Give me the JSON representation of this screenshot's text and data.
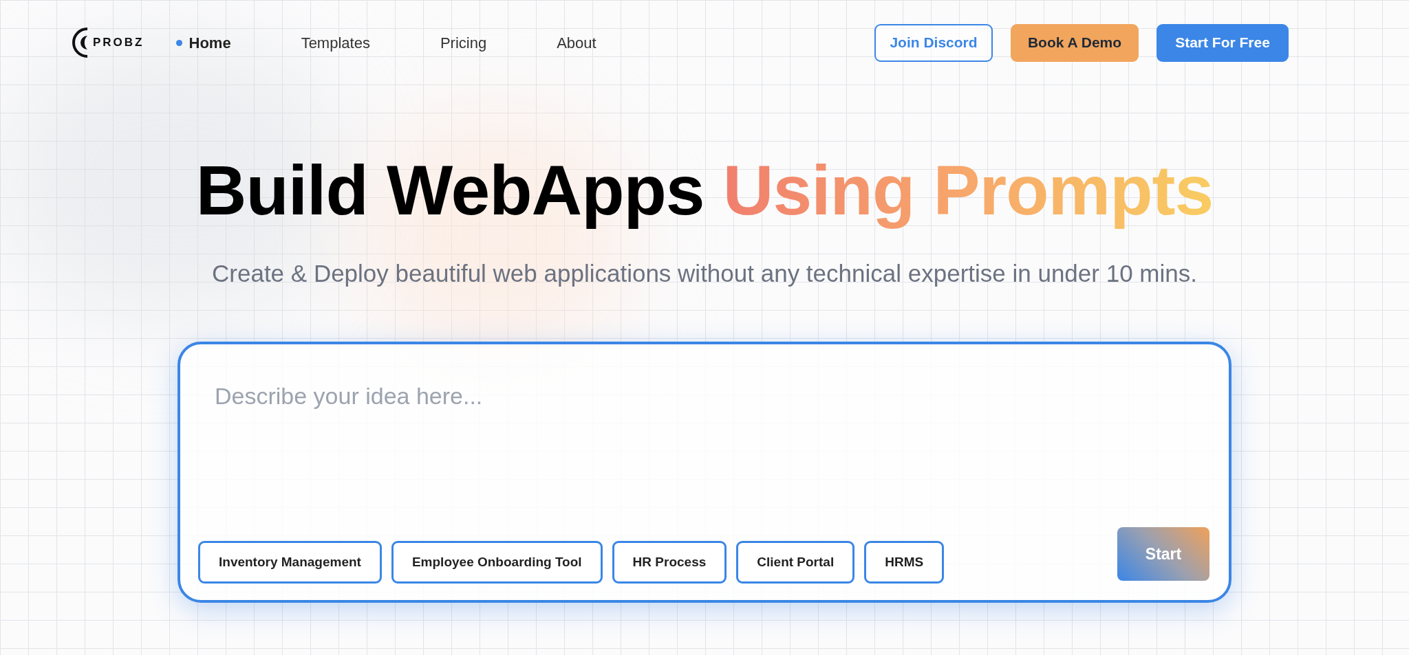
{
  "logo": {
    "text": "PROBZ"
  },
  "nav": [
    {
      "label": "Home",
      "selected": true
    },
    {
      "label": "Templates",
      "selected": false
    },
    {
      "label": "Pricing",
      "selected": false
    },
    {
      "label": "About",
      "selected": false
    }
  ],
  "actions": [
    {
      "label": "Join Discord",
      "kind": "outline"
    },
    {
      "label": "Book A Demo",
      "kind": "orange"
    },
    {
      "label": "Start For Free",
      "kind": "primary"
    }
  ],
  "headline": {
    "text": "Build WebApps",
    "highlight": "Using Prompts"
  },
  "subtitle": "Create & Deploy beautiful web applications without any technical expertise in under 10 mins.",
  "prompt": {
    "placeholder": "Describe your idea here...",
    "suggestions": [
      "Inventory Management",
      "Employee Onboarding Tool",
      "HR Process",
      "Client Portal",
      "HRMS"
    ],
    "submit": "Start"
  }
}
